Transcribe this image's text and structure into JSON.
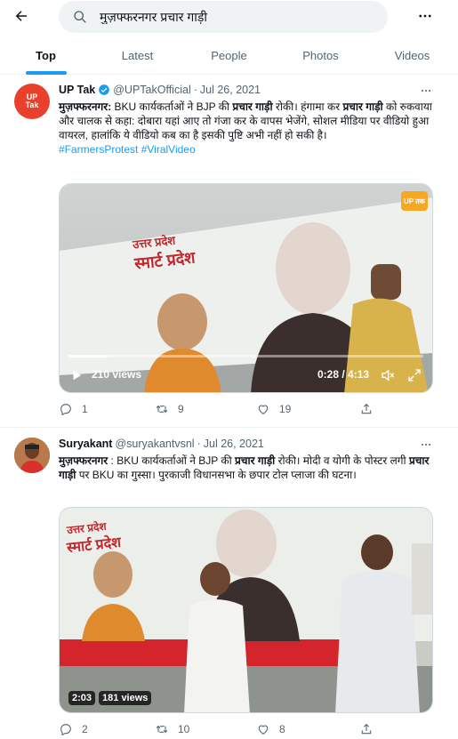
{
  "search": {
    "query": "मुज़फ्फरनगर प्रचार गाड़ी"
  },
  "tabs": [
    "Top",
    "Latest",
    "People",
    "Photos",
    "Videos"
  ],
  "tweets": [
    {
      "name": "UP Tak",
      "avatar_text": "UP\nTak",
      "handle": "@UPTakOfficial",
      "dot": "·",
      "date": "Jul 26, 2021",
      "text_lead": "मुज़फ्फरनगर:",
      "text_a": " BKU कार्यकर्ताओं ने BJP की ",
      "text_bold_a": "प्रचार गाड़ी",
      "text_b": " रोकी। हंगामा कर ",
      "text_bold_b": "प्रचार गाड़ी",
      "text_c": " को रुकवाया और चालक से कहा: दोबारा यहां आए तो गंजा कर के वापस भेजेंगे, सोशल मीडिया पर वीडियो हुआ वायरल, हालांकि ये वीडियो कब का है इसकी पुष्टि अभी नहीं हो सकी है।",
      "hashtags": "#FarmersProtest #ViralVideo",
      "media": {
        "badge": "UP तक",
        "banner_line1": "उत्तर प्रदेश",
        "banner_line2": "स्मार्ट प्रदेश",
        "views": "210 views",
        "time": "0:28 / 4:13"
      },
      "replies": "1",
      "retweets": "9",
      "likes": "19"
    },
    {
      "name": "Suryakant",
      "handle": "@suryakantvsnl",
      "dot": "·",
      "date": "Jul 26, 2021",
      "text_lead": "मुज़फ्फरनगर",
      "text_a": " : BKU कार्यकर्ताओं ने BJP की ",
      "text_bold_a": "प्रचार गाड़ी",
      "text_b": " रोकी। मोदी व योगी के पोस्टर लगी ",
      "text_bold_b": "प्रचार गाड़ी",
      "text_c": " पर BKU का गुस्सा। पुरकाजी विधानसभा के छपार टोल प्लाजा की घटना।",
      "media": {
        "banner_line1": "उत्तर प्रदेश",
        "banner_line2": "स्मार्ट प्रदेश",
        "duration": "2:03",
        "views": "181 views"
      },
      "replies": "2",
      "retweets": "10",
      "likes": "8"
    }
  ]
}
